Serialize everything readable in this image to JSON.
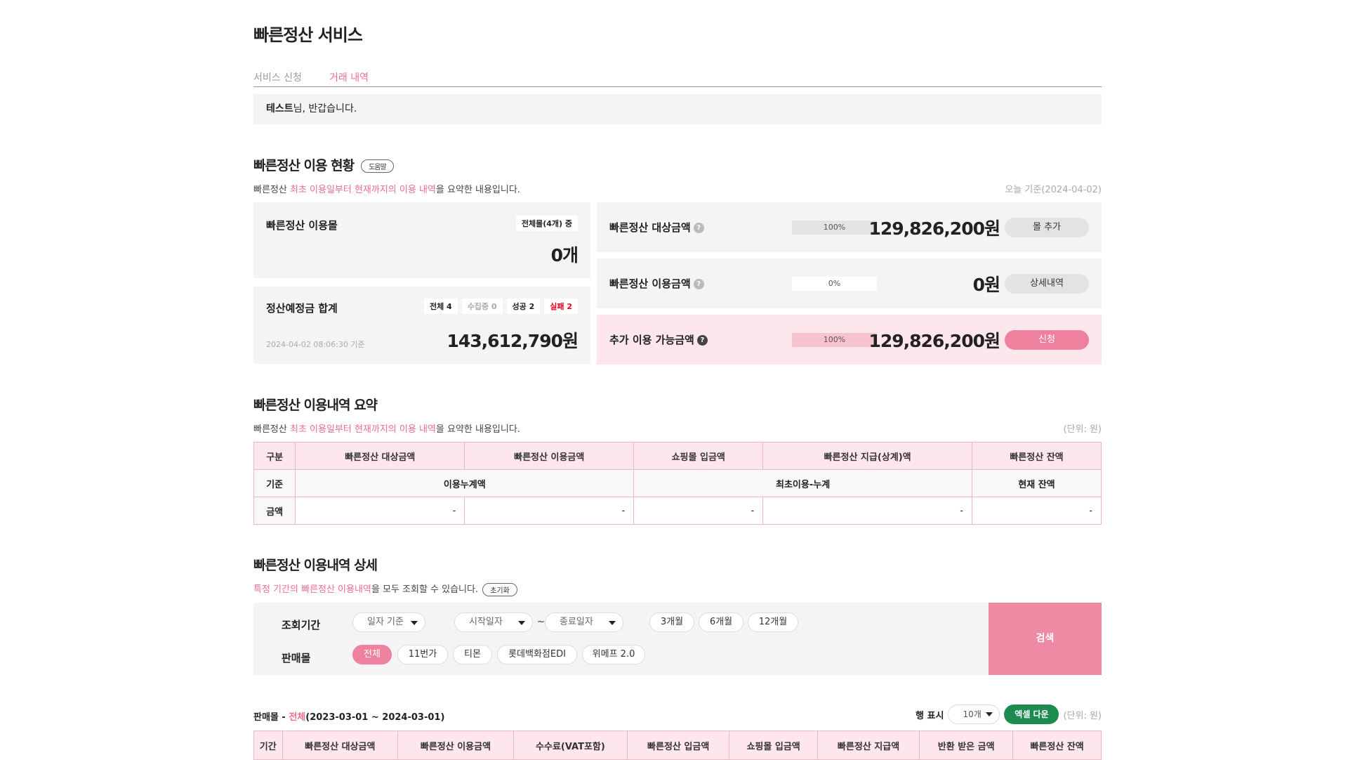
{
  "page_title": "빠른정산 서비스",
  "tabs": [
    {
      "label": "서비스 신청",
      "active": false
    },
    {
      "label": "거래 내역",
      "active": true
    }
  ],
  "greeting": {
    "name": "테스트",
    "suffix": "님, 반갑습니다."
  },
  "status": {
    "title": "빠른정산 이용 현황",
    "help_label": "도움말",
    "desc_pre": "빠른정산 ",
    "desc_pink": "최초 이용일부터 현재까지의 이용 내역",
    "desc_post": "을 요약한 내용입니다.",
    "date_note": "오늘 기준(2024-04-02)",
    "malls_card": {
      "label": "빠른정산 이용몰",
      "tag": "전체몰(4개) 중",
      "value": "0개"
    },
    "settle_card": {
      "label": "정산예정금 합계",
      "tags": {
        "all": "전체 4",
        "collecting": "수집중 0",
        "success": "성공 2",
        "fail": "실패 2"
      },
      "timestamp": "2024-04-02 08:06:30 기준",
      "value": "143,612,790원"
    },
    "rows": [
      {
        "label": "빠른정산 대상금액",
        "percent": 100,
        "percent_text": "100%",
        "amount": "129,826,200원",
        "button": "몰 추가"
      },
      {
        "label": "빠른정산 이용금액",
        "percent": 0,
        "percent_text": "0%",
        "amount": "0원",
        "button": "상세내역"
      },
      {
        "label": "추가 이용 가능금액",
        "percent": 100,
        "percent_text": "100%",
        "amount": "129,826,200원",
        "button": "신청"
      }
    ]
  },
  "summary": {
    "title": "빠른정산 이용내역 요약",
    "desc_pre": "빠른정산 ",
    "desc_pink": "최초 이용일부터 현재까지의 이용 내역",
    "desc_post": "을 요약한 내용입니다.",
    "unit_note": "(단위: 원)",
    "headers": [
      "구분",
      "빠른정산 대상금액",
      "빠른정산 이용금액",
      "쇼핑몰 입금액",
      "빠른정산 지급(상계)액",
      "빠른정산 잔액"
    ],
    "basis_label": "기준",
    "basis_cumulative": "이용누계액",
    "basis_first": "최초이용-누계",
    "basis_current": "현재 잔액",
    "amount_label": "금액",
    "amounts": [
      "-",
      "-",
      "-",
      "-",
      "-"
    ]
  },
  "detail": {
    "title": "빠른정산 이용내역 상세",
    "desc_pink": "특정 기간의 빠른정산 이용내역",
    "desc_post": "을 모두 조회할 수 있습니다.",
    "reset_label": "초기화",
    "period_label": "조회기간",
    "date_basis": "일자 기준",
    "start_placeholder": "시작일자",
    "tilde": "~",
    "end_placeholder": "종료일자",
    "quick_ranges": [
      "3개월",
      "6개월",
      "12개월"
    ],
    "mall_label": "판매몰",
    "malls": [
      "전체",
      "11번가",
      "티몬",
      "롯데백화점EDI",
      "위메프 2.0"
    ],
    "search_label": "검색",
    "result_prefix": "판매몰 - ",
    "result_mall": "전체",
    "result_range": "(2023-03-01 ~ 2024-03-01)",
    "rows_label": "행 표시",
    "rows_value": "10개",
    "excel_label": "엑셀 다운",
    "unit_note": "(단위: 원)",
    "headers": [
      "기간",
      "빠른정산 대상금액",
      "빠른정산 이용금액",
      "수수료(VAT포함)",
      "빠른정산 입금액",
      "쇼핑몰 입금액",
      "빠른정산 지급액",
      "반환 받은 금액",
      "빠른정산 잔액"
    ]
  }
}
